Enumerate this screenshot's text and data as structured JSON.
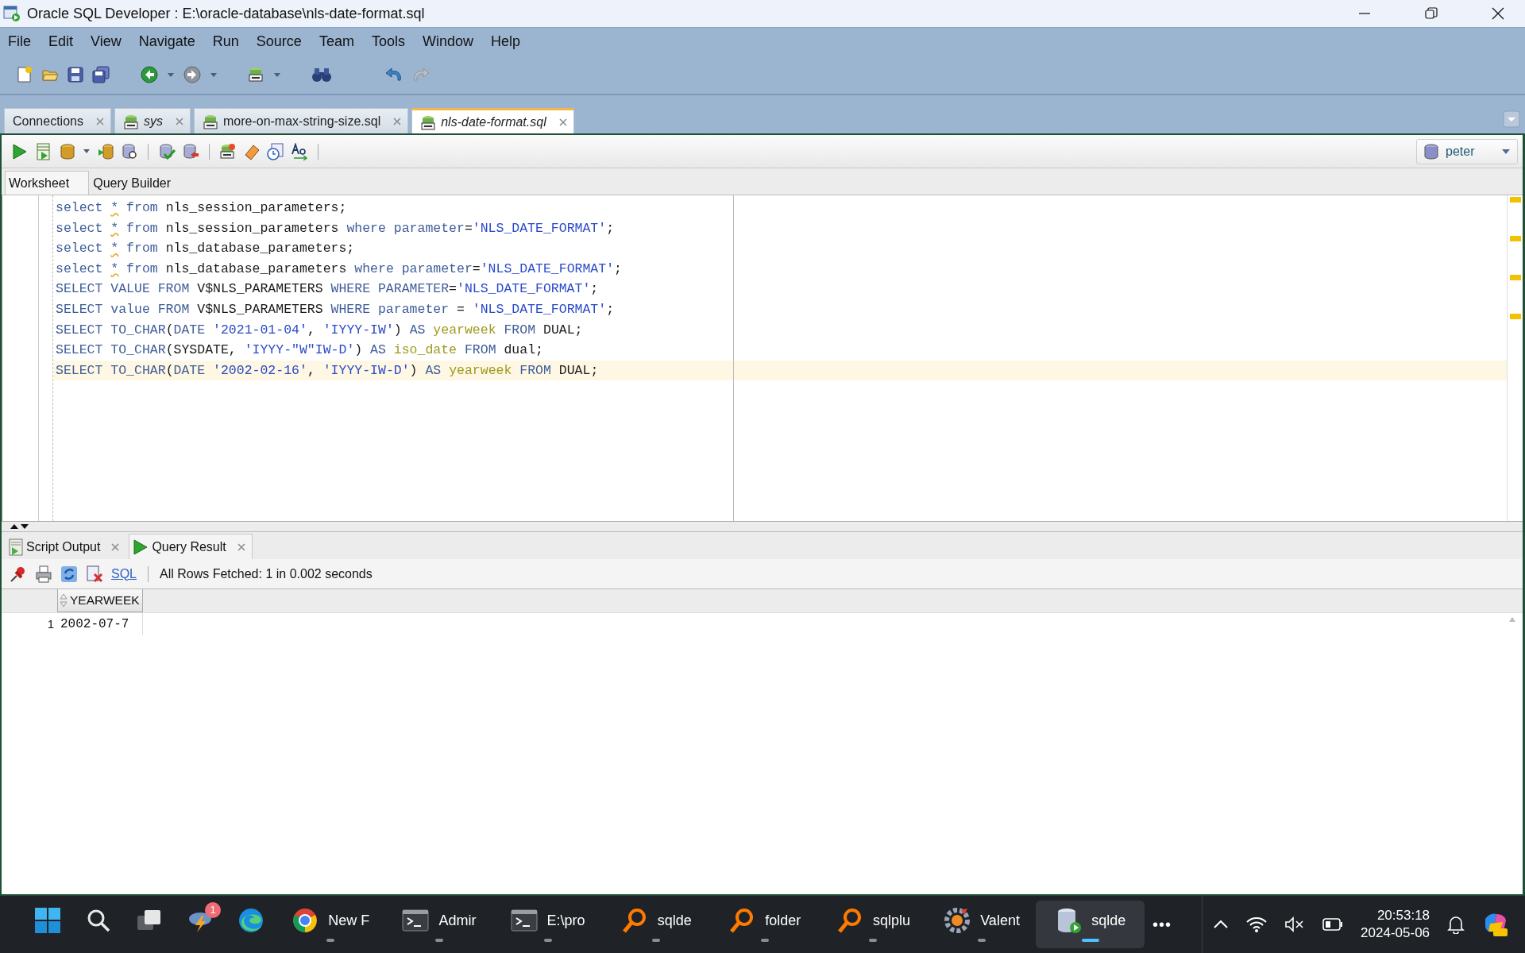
{
  "window": {
    "title": "Oracle SQL Developer : E:\\oracle-database\\nls-date-format.sql"
  },
  "menu": [
    "File",
    "Edit",
    "View",
    "Navigate",
    "Run",
    "Source",
    "Team",
    "Tools",
    "Window",
    "Help"
  ],
  "document_tabs": [
    {
      "label": "Connections",
      "kind": "panel",
      "italic": false,
      "selected": false
    },
    {
      "label": "sys",
      "kind": "sql",
      "italic": true,
      "selected": false
    },
    {
      "label": "more-on-max-string-size.sql",
      "kind": "sql",
      "italic": false,
      "selected": false
    },
    {
      "label": "nls-date-format.sql",
      "kind": "sql",
      "italic": true,
      "selected": true
    }
  ],
  "connection": "peter",
  "editor_tabs": [
    {
      "label": "Worksheet",
      "selected": true
    },
    {
      "label": "Query Builder",
      "selected": false
    }
  ],
  "code_lines": [
    {
      "current": false,
      "tokens": [
        {
          "kind": "keyword",
          "text": "select "
        },
        {
          "kind": "warn",
          "text": "*"
        },
        {
          "kind": "keyword",
          "text": " from"
        },
        {
          "kind": "plain",
          "text": " nls_session_parameters;"
        }
      ]
    },
    {
      "current": false,
      "tokens": [
        {
          "kind": "keyword",
          "text": "select "
        },
        {
          "kind": "warn",
          "text": "*"
        },
        {
          "kind": "keyword",
          "text": " from"
        },
        {
          "kind": "plain",
          "text": " nls_session_parameters "
        },
        {
          "kind": "keyword",
          "text": "where parameter"
        },
        {
          "kind": "plain",
          "text": "="
        },
        {
          "kind": "string",
          "text": "'NLS_DATE_FORMAT'"
        },
        {
          "kind": "plain",
          "text": ";"
        }
      ]
    },
    {
      "current": false,
      "tokens": [
        {
          "kind": "keyword",
          "text": "select "
        },
        {
          "kind": "warn",
          "text": "*"
        },
        {
          "kind": "keyword",
          "text": " from"
        },
        {
          "kind": "plain",
          "text": " nls_database_parameters;"
        }
      ]
    },
    {
      "current": false,
      "tokens": [
        {
          "kind": "keyword",
          "text": "select "
        },
        {
          "kind": "warn",
          "text": "*"
        },
        {
          "kind": "keyword",
          "text": " from"
        },
        {
          "kind": "plain",
          "text": " nls_database_parameters "
        },
        {
          "kind": "keyword",
          "text": "where parameter"
        },
        {
          "kind": "plain",
          "text": "="
        },
        {
          "kind": "string",
          "text": "'NLS_DATE_FORMAT'"
        },
        {
          "kind": "plain",
          "text": ";"
        }
      ]
    },
    {
      "current": false,
      "tokens": [
        {
          "kind": "keyword",
          "text": "SELECT VALUE FROM"
        },
        {
          "kind": "plain",
          "text": " V$NLS_PARAMETERS "
        },
        {
          "kind": "keyword",
          "text": "WHERE PARAMETER"
        },
        {
          "kind": "plain",
          "text": "="
        },
        {
          "kind": "string",
          "text": "'NLS_DATE_FORMAT'"
        },
        {
          "kind": "plain",
          "text": ";"
        }
      ]
    },
    {
      "current": false,
      "tokens": [
        {
          "kind": "keyword",
          "text": "SELECT value FROM"
        },
        {
          "kind": "plain",
          "text": " V$NLS_PARAMETERS "
        },
        {
          "kind": "keyword",
          "text": "WHERE parameter"
        },
        {
          "kind": "plain",
          "text": " = "
        },
        {
          "kind": "string",
          "text": "'NLS_DATE_FORMAT'"
        },
        {
          "kind": "plain",
          "text": ";"
        }
      ]
    },
    {
      "current": false,
      "tokens": [
        {
          "kind": "keyword",
          "text": "SELECT TO_CHAR"
        },
        {
          "kind": "plain",
          "text": "("
        },
        {
          "kind": "keyword",
          "text": "DATE "
        },
        {
          "kind": "string",
          "text": "'2021-01-04'"
        },
        {
          "kind": "plain",
          "text": ", "
        },
        {
          "kind": "string",
          "text": "'IYYY-IW'"
        },
        {
          "kind": "plain",
          "text": ") "
        },
        {
          "kind": "keyword",
          "text": "AS "
        },
        {
          "kind": "alias",
          "text": "yearweek"
        },
        {
          "kind": "keyword",
          "text": " FROM"
        },
        {
          "kind": "plain",
          "text": " DUAL;"
        }
      ]
    },
    {
      "current": false,
      "tokens": [
        {
          "kind": "keyword",
          "text": "SELECT TO_CHAR"
        },
        {
          "kind": "plain",
          "text": "(SYSDATE, "
        },
        {
          "kind": "string",
          "text": "'IYYY-\"W\"IW-D'"
        },
        {
          "kind": "plain",
          "text": ") "
        },
        {
          "kind": "keyword",
          "text": "AS "
        },
        {
          "kind": "alias",
          "text": "iso_date"
        },
        {
          "kind": "keyword",
          "text": " FROM"
        },
        {
          "kind": "plain",
          "text": " dual;"
        }
      ]
    },
    {
      "current": true,
      "tokens": [
        {
          "kind": "keyword",
          "text": "SELECT TO_CHAR"
        },
        {
          "kind": "plain",
          "text": "("
        },
        {
          "kind": "keyword",
          "text": "DATE "
        },
        {
          "kind": "string",
          "text": "'2002-02-16'"
        },
        {
          "kind": "plain",
          "text": ", "
        },
        {
          "kind": "string",
          "text": "'IYYY-IW-D'"
        },
        {
          "kind": "plain",
          "text": ") "
        },
        {
          "kind": "keyword",
          "text": "AS "
        },
        {
          "kind": "alias",
          "text": "yearweek"
        },
        {
          "kind": "keyword",
          "text": " FROM"
        },
        {
          "kind": "plain",
          "text": " DUAL;"
        }
      ]
    }
  ],
  "output_tabs": [
    {
      "label": "Script Output",
      "kind": "script",
      "selected": false
    },
    {
      "label": "Query Result",
      "kind": "query",
      "selected": true
    }
  ],
  "result_toolbar": {
    "sql_link": "SQL",
    "status": "All Rows Fetched: 1 in 0.002 seconds"
  },
  "result_table": {
    "columns": [
      "YEARWEEK"
    ],
    "rows": [
      {
        "number": "1",
        "cells": [
          "2002-07-7"
        ]
      }
    ]
  },
  "taskbar": {
    "weather_badge": "1",
    "apps": [
      {
        "label": "New F",
        "running": true,
        "active": false
      },
      {
        "label": "Admir",
        "running": true,
        "active": false
      },
      {
        "label": "E:\\pro",
        "running": true,
        "active": false
      },
      {
        "label": "sqlde",
        "running": true,
        "active": false
      },
      {
        "label": "folder",
        "running": true,
        "active": false
      },
      {
        "label": "sqlplu",
        "running": true,
        "active": false
      },
      {
        "label": "Valent",
        "running": true,
        "active": false
      },
      {
        "label": "sqlde",
        "running": true,
        "active": true
      }
    ],
    "overflow": "•••",
    "time": "20:53:18",
    "date": "2024-05-06"
  }
}
